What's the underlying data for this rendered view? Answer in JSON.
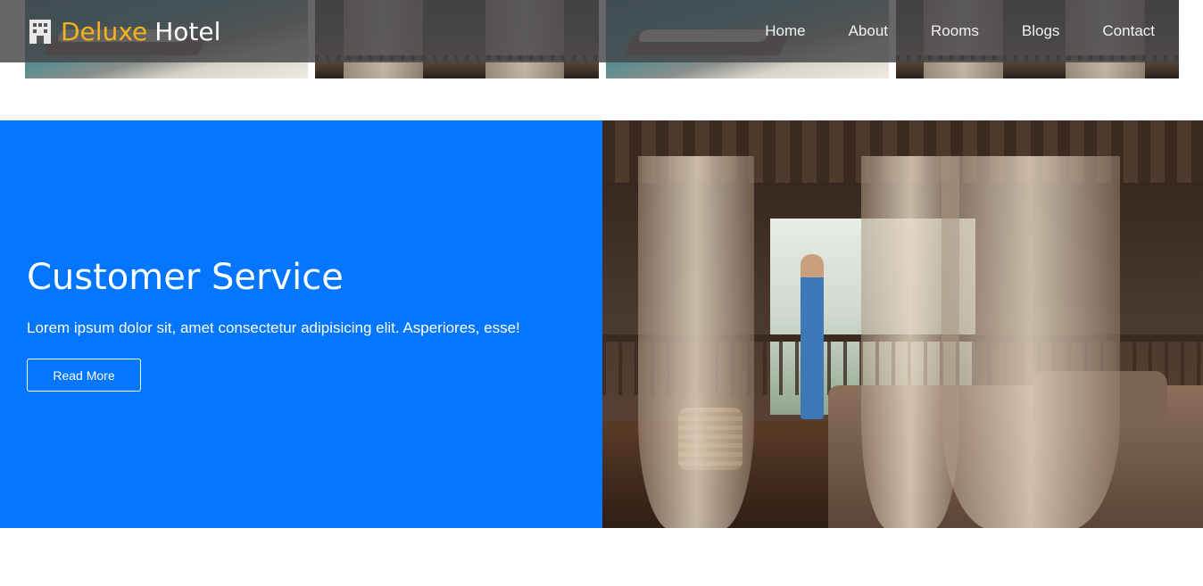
{
  "brand": {
    "primary": "Deluxe",
    "secondary": "Hotel",
    "icon": "hotel-building-icon"
  },
  "nav": {
    "items": [
      {
        "label": "Home"
      },
      {
        "label": "About"
      },
      {
        "label": "Rooms"
      },
      {
        "label": "Blogs"
      },
      {
        "label": "Contact"
      }
    ]
  },
  "feature": {
    "title": "Customer Service",
    "text": "Lorem ipsum dolor sit, amet consectetur adipisicing elit. Asperiores, esse!",
    "button_label": "Read More"
  },
  "colors": {
    "accent": "#f5b21b",
    "feature_bg": "#0276fe",
    "navbar_bg": "#464648"
  }
}
